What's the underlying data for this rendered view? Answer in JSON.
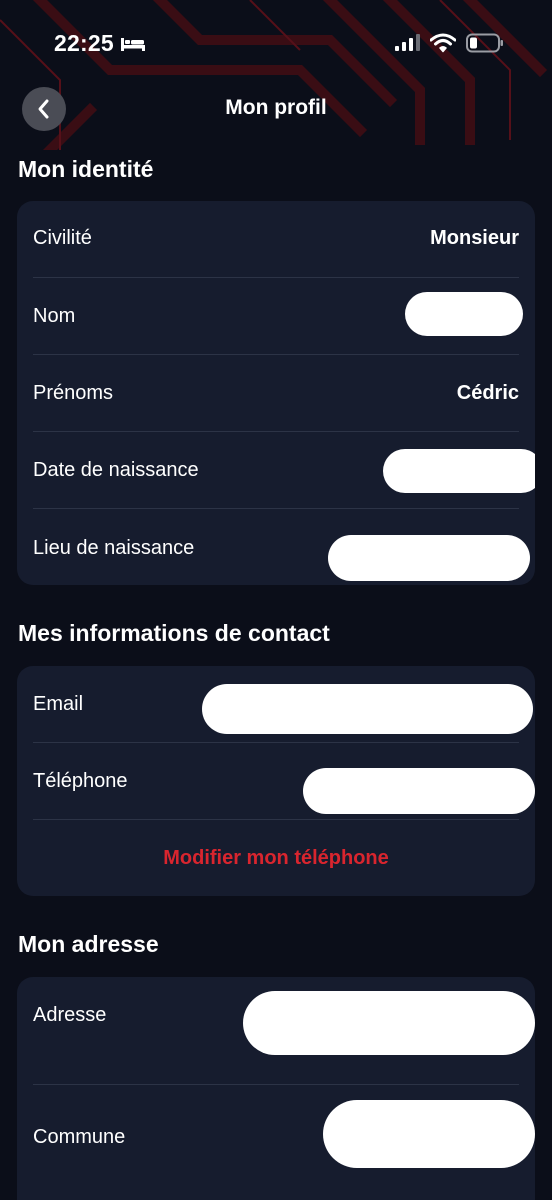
{
  "status_bar": {
    "time": "22:25",
    "icons": [
      "bed-icon",
      "cellular-signal-icon",
      "wifi-icon",
      "battery-icon"
    ]
  },
  "header": {
    "title": "Mon profil",
    "back_icon": "chevron-left-icon"
  },
  "identity": {
    "title": "Mon identité",
    "rows": [
      {
        "label": "Civilité",
        "value": "Monsieur"
      },
      {
        "label": "Nom",
        "value": ""
      },
      {
        "label": "Prénoms",
        "value": "Cédric"
      },
      {
        "label": "Date de naissance",
        "value": ""
      },
      {
        "label": "Lieu de naissance",
        "value": ""
      }
    ]
  },
  "contact": {
    "title": "Mes informations de contact",
    "rows": [
      {
        "label": "Email",
        "value": ""
      },
      {
        "label": "Téléphone",
        "value": ""
      }
    ],
    "action_label": "Modifier mon téléphone"
  },
  "address": {
    "title": "Mon adresse",
    "rows": [
      {
        "label": "Adresse",
        "value": ""
      },
      {
        "label": "Commune",
        "value": ""
      }
    ]
  },
  "colors": {
    "background": "#0b0e19",
    "card": "#161c2e",
    "accent": "#d9252e",
    "divider": "#2c3346"
  }
}
